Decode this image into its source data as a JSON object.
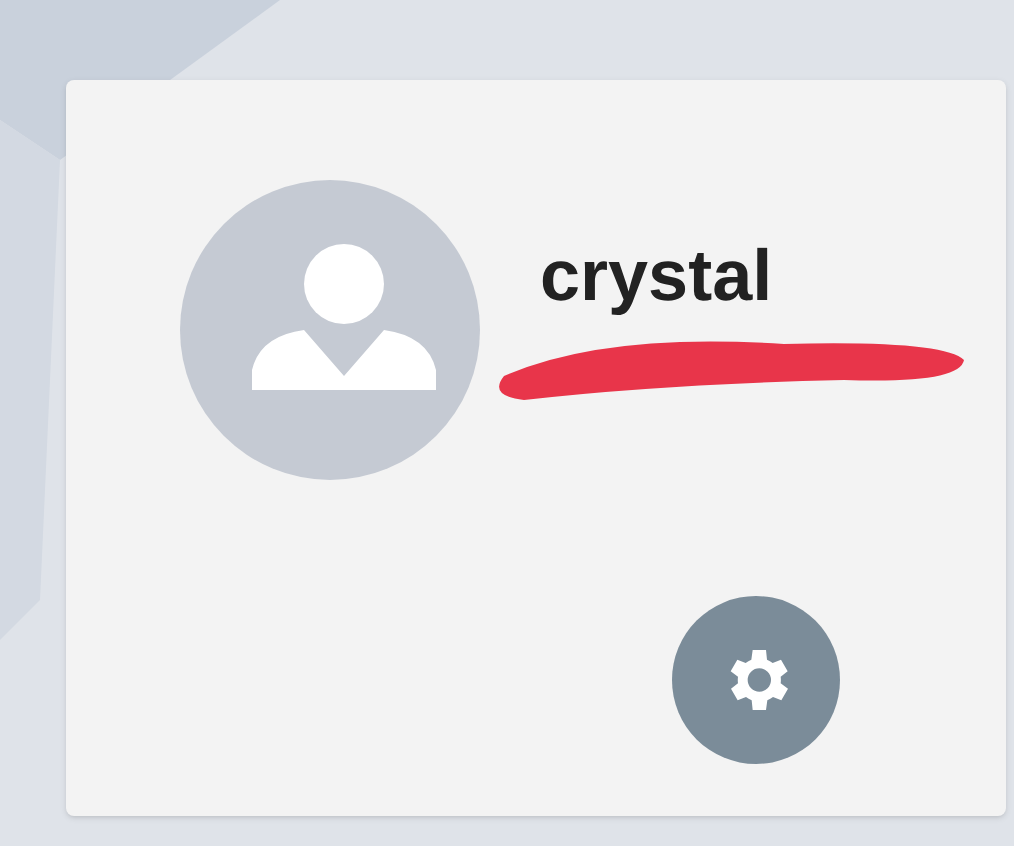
{
  "profile": {
    "username": "crystal"
  }
}
